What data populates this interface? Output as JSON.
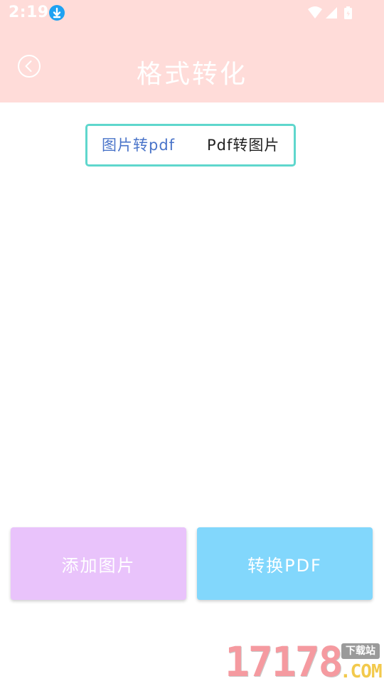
{
  "status_bar": {
    "time": "2:19",
    "icons": [
      "download-icon",
      "wifi-icon",
      "signal-icon",
      "battery-icon"
    ]
  },
  "app_bar": {
    "title": "格式转化",
    "back_icon": "back-arrow-circle-icon"
  },
  "tabs": [
    {
      "label": "图片转pdf",
      "active": true
    },
    {
      "label": "Pdf转图片",
      "active": false
    }
  ],
  "actions": {
    "add_images_label": "添加图片",
    "convert_label": "转换PDF"
  },
  "watermark": {
    "digits": "17178",
    "tag": "下载站",
    "domain": ".COM"
  },
  "colors": {
    "header_bg": "#ffdcd9",
    "tab_border": "#5fd7cd",
    "tab_active_text": "#4a74c9",
    "add_button_bg": "#e9c3fb",
    "convert_button_bg": "#82d7fc"
  }
}
